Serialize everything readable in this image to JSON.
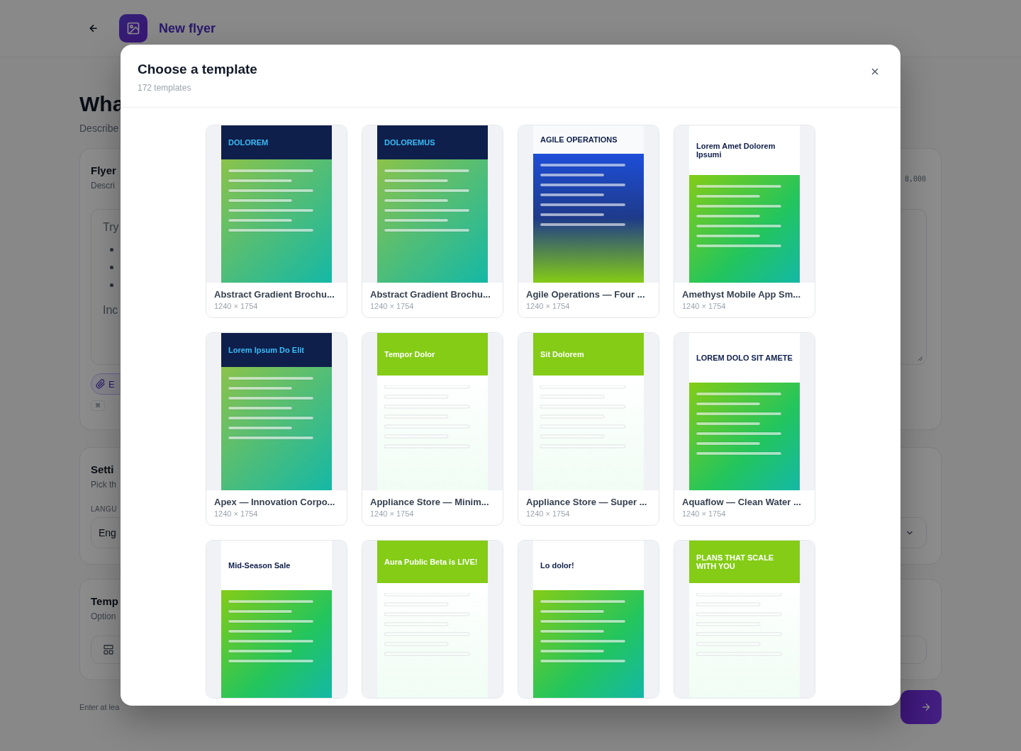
{
  "page": {
    "title": "New flyer",
    "heading": "Wha",
    "subheading": "Describe"
  },
  "flyer_card": {
    "title": "Flyer",
    "description": "Descri",
    "counter": "8,000",
    "prompt_lines": [
      "Try",
      "Inc"
    ],
    "attach_button": "E",
    "shortcut_key": "⌘"
  },
  "settings_card": {
    "title": "Setti",
    "description": "Pick th",
    "language_label": "LANGU",
    "language_value": "Eng"
  },
  "template_card": {
    "title": "Temp",
    "description": "Option"
  },
  "footer_hint": "Enter at lea",
  "modal": {
    "title": "Choose a template",
    "subtitle": "172 templates",
    "templates": [
      {
        "title": "Abstract Gradient Brochu...",
        "size": "1240 × 1754",
        "preview_heading": "DOLOREM"
      },
      {
        "title": "Abstract Gradient Brochu...",
        "size": "1240 × 1754",
        "preview_heading": "DOLOREMUS"
      },
      {
        "title": "Agile Operations — Four ...",
        "size": "1240 × 1754",
        "preview_heading": "AGILE OPERATIONS"
      },
      {
        "title": "Amethyst Mobile App Sm...",
        "size": "1240 × 1754",
        "preview_heading": "Lorem Amet Dolorem Ipsumi"
      },
      {
        "title": "Apex — Innovation Corpo...",
        "size": "1240 × 1754",
        "preview_heading": "Lorem Ipsum Do Elit"
      },
      {
        "title": "Appliance Store — Minim...",
        "size": "1240 × 1754",
        "preview_heading": "Tempor Dolor"
      },
      {
        "title": "Appliance Store — Super ...",
        "size": "1240 × 1754",
        "preview_heading": "Sit Dolorem"
      },
      {
        "title": "Aquaflow — Clean Water ...",
        "size": "1240 × 1754",
        "preview_heading": "LOREM DOLO SIT AMETE"
      },
      {
        "preview_heading": "Mid-Season Sale"
      },
      {
        "preview_heading": "Aura Public Beta is LIVE!"
      },
      {
        "preview_heading": "Lo dolor!"
      },
      {
        "preview_heading": "PLANS THAT SCALE WITH YOU"
      }
    ]
  }
}
